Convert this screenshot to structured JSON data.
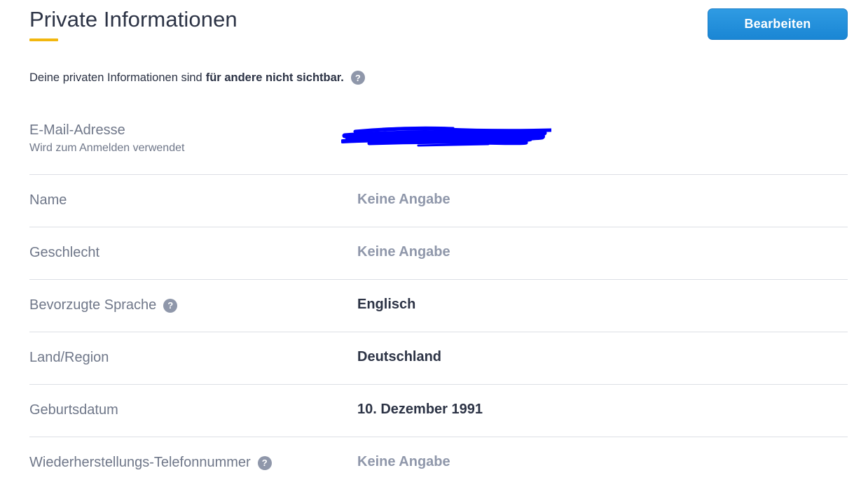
{
  "header": {
    "title": "Private Informationen",
    "edit_button": "Bearbeiten"
  },
  "notice": {
    "text": "Deine privaten Informationen sind",
    "bold": "für andere nicht sichtbar.",
    "help_icon": "?"
  },
  "colors": {
    "accent_underline": "#f2b70f",
    "button": "#1a86d4",
    "redaction": "#0000ff"
  },
  "fields": {
    "email": {
      "label": "E-Mail-Adresse",
      "sublabel": "Wird zum Anmelden verwendet"
    },
    "name": {
      "label": "Name",
      "value": "Keine Angabe"
    },
    "gender": {
      "label": "Geschlecht",
      "value": "Keine Angabe"
    },
    "language": {
      "label": "Bevorzugte Sprache",
      "help_icon": "?",
      "value": "Englisch"
    },
    "country": {
      "label": "Land/Region",
      "value": "Deutschland"
    },
    "birthdate": {
      "label": "Geburtsdatum",
      "value": "10. Dezember 1991"
    },
    "recovery_phone": {
      "label": "Wiederherstellungs-Telefonnummer",
      "help_icon": "?",
      "value": "Keine Angabe"
    }
  }
}
